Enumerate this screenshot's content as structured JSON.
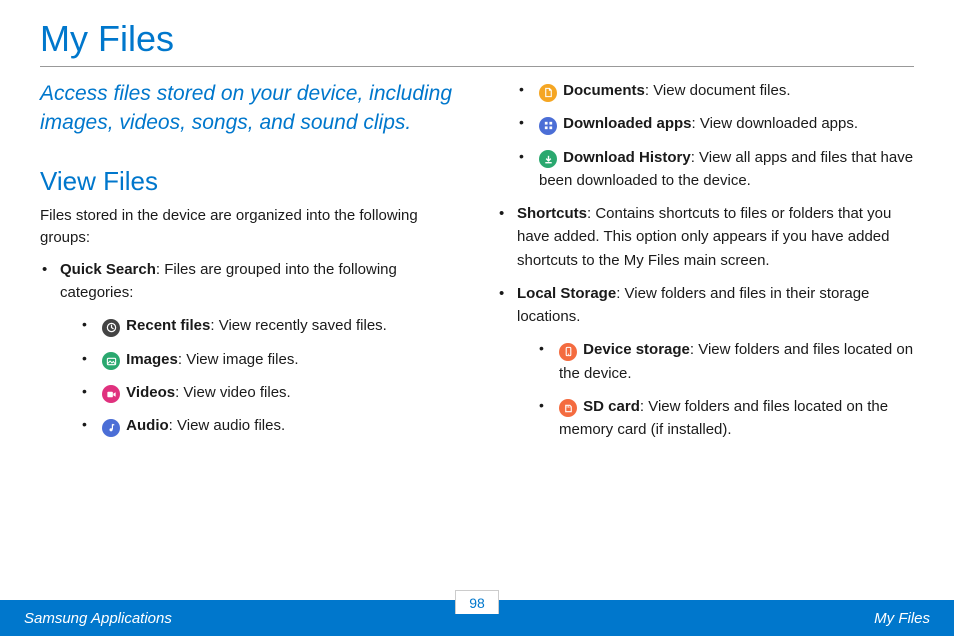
{
  "title": "My Files",
  "subtitle": "Access files stored on your device, including images, videos, songs, and sound clips.",
  "section": {
    "heading": "View Files",
    "intro": "Files stored in the device are organized into the following groups:"
  },
  "quickSearch": {
    "label": "Quick Search",
    "desc": ": Files are grouped into the following categories:",
    "items": {
      "recent": {
        "label": "Recent files",
        "desc": ": View recently saved files."
      },
      "images": {
        "label": "Images",
        "desc": ": View image files."
      },
      "videos": {
        "label": "Videos",
        "desc": ": View video files."
      },
      "audio": {
        "label": "Audio",
        "desc": ": View audio files."
      },
      "documents": {
        "label": "Documents",
        "desc": ": View document files."
      },
      "downapps": {
        "label": "Downloaded apps",
        "desc": ": View downloaded apps."
      },
      "downhist": {
        "label": "Download History",
        "desc": ": View all apps and files that have been downloaded to the device."
      }
    }
  },
  "shortcuts": {
    "label": "Shortcuts",
    "desc": ": Contains shortcuts to files or folders that you have added. This option only appears if you have added shortcuts to the My Files main screen."
  },
  "localStorage": {
    "label": "Local Storage",
    "desc": ": View folders and files in their storage locations.",
    "items": {
      "device": {
        "label": "Device storage",
        "desc": ": View folders and files located on the device."
      },
      "sd": {
        "label": "SD card",
        "desc": ": View folders and files located on the memory card (if installed)."
      }
    }
  },
  "footer": {
    "left": "Samsung Applications",
    "page": "98",
    "right": "My Files"
  }
}
